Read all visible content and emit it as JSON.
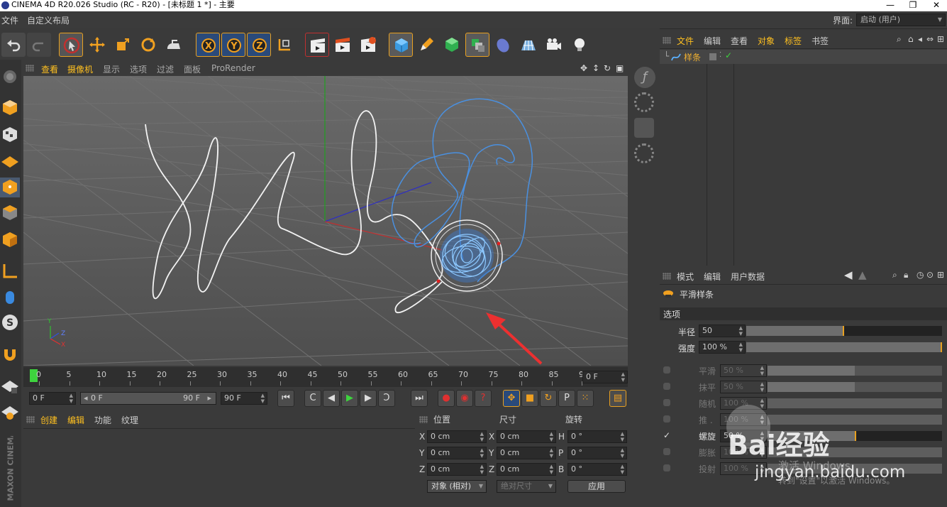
{
  "window": {
    "title": "CINEMA 4D R20.026 Studio (RC - R20) - [未标题 1 *] - 主要",
    "minimize": "—",
    "maximize": "❐",
    "close": "✕"
  },
  "menubar": {
    "items": [
      "文件",
      "自定义布局"
    ],
    "layout_label": "界面:",
    "layout_value": "启动 (用户)"
  },
  "viewport": {
    "menu": [
      "查看",
      "摄像机",
      "显示",
      "选项",
      "过滤",
      "面板",
      "ProRender"
    ],
    "axis_labels": {
      "y": "Y",
      "z": "Z",
      "x": "X"
    }
  },
  "timeline": {
    "ticks": [
      "0",
      "5",
      "10",
      "15",
      "20",
      "25",
      "30",
      "35",
      "40",
      "45",
      "50",
      "55",
      "60",
      "65",
      "70",
      "75",
      "80",
      "85",
      "90"
    ],
    "current_frame": "0 F"
  },
  "transport": {
    "start_field": "0 F",
    "range_start": "0 F",
    "range_end": "90 F",
    "end_field": "90 F"
  },
  "materials": {
    "menu": [
      "创建",
      "编辑",
      "功能",
      "纹理"
    ]
  },
  "coordinates": {
    "headers": [
      "位置",
      "尺寸",
      "旋转"
    ],
    "rows": [
      {
        "pos_axis": "X",
        "pos": "0 cm",
        "size_axis": "X",
        "size": "0 cm",
        "rot_axis": "H",
        "rot": "0 °"
      },
      {
        "pos_axis": "Y",
        "pos": "0 cm",
        "size_axis": "Y",
        "size": "0 cm",
        "rot_axis": "P",
        "rot": "0 °"
      },
      {
        "pos_axis": "Z",
        "pos": "0 cm",
        "size_axis": "Z",
        "size": "0 cm",
        "rot_axis": "B",
        "rot": "0 °"
      }
    ],
    "mode_select": "对象 (相对)",
    "size_select": "绝对尺寸",
    "apply": "应用"
  },
  "objects": {
    "menu": [
      "文件",
      "编辑",
      "查看",
      "对象",
      "标签",
      "书签"
    ],
    "items": [
      {
        "name": "样条"
      }
    ]
  },
  "attributes": {
    "menu": [
      "模式",
      "编辑",
      "用户数据"
    ],
    "object_name": "平滑样条",
    "section": "选项",
    "radius_label": "半径",
    "radius_value": "50",
    "radius_fraction": 0.5,
    "strength_label": "强度",
    "strength_value": "100 %",
    "strength_fraction": 1.0,
    "params": [
      {
        "label": "平滑",
        "value": "50 %",
        "fraction": 0.5,
        "enabled": false
      },
      {
        "label": "抹平",
        "value": "50 %",
        "fraction": 0.5,
        "enabled": false
      },
      {
        "label": "随机",
        "value": "100 %",
        "fraction": 1.0,
        "enabled": false
      },
      {
        "label": "推 .",
        "value": "100 %",
        "fraction": 1.0,
        "enabled": false
      },
      {
        "label": "螺旋",
        "value": "50 %",
        "fraction": 0.5,
        "enabled": true
      },
      {
        "label": "膨胀",
        "value": "100 %",
        "fraction": 1.0,
        "enabled": false
      },
      {
        "label": "投射",
        "value": "100 %",
        "fraction": 1.0,
        "enabled": false
      }
    ]
  },
  "watermark": {
    "activate_title": "激活 Windows",
    "activate_sub": "转到\"设置\"以激活 Windows。",
    "baidu": "Bai经验",
    "site": "jingyan.baidu.com"
  },
  "brand": "MAXON CINEMA 4D",
  "colors": {
    "accent": "#e8a020",
    "active_tab": "#ffc020",
    "spline_blue": "#4a90e0",
    "arrow_red": "#e83030"
  }
}
